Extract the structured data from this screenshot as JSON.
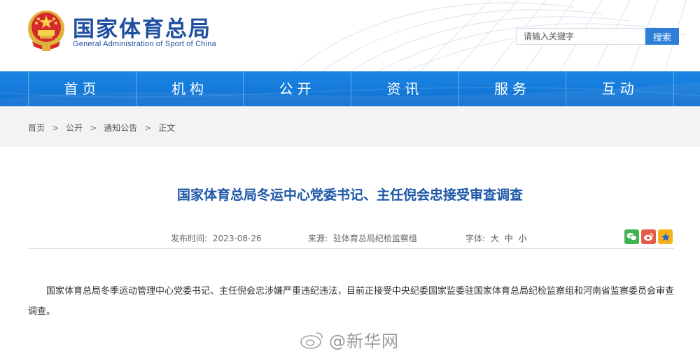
{
  "header": {
    "logo_cn": "国家体育总局",
    "logo_en": "General Administration of Sport of China",
    "search_placeholder": "请输入关键字",
    "search_button": "搜索"
  },
  "nav": {
    "items": [
      {
        "label": "首页"
      },
      {
        "label": "机构"
      },
      {
        "label": "公开"
      },
      {
        "label": "资讯"
      },
      {
        "label": "服务"
      },
      {
        "label": "互动"
      }
    ]
  },
  "breadcrumb": {
    "items": [
      "首页",
      "公开",
      "通知公告",
      "正文"
    ],
    "separator": ">"
  },
  "article": {
    "title": "国家体育总局冬运中心党委书记、主任倪会忠接受审查调查",
    "publish_label": "发布时间:",
    "publish_date": "2023-08-26",
    "source_label": "来源:",
    "source_value": "驻体育总局纪检监察组",
    "font_label": "字体:",
    "font_large": "大",
    "font_medium": "中",
    "font_small": "小",
    "body": "国家体育总局冬季运动管理中心党委书记、主任倪会忠涉嫌严重违纪违法，目前正接受中央纪委国家监委驻国家体育总局纪检监察组和河南省监察委员会审查调查。"
  },
  "share": {
    "icons": [
      "wechat-icon",
      "weibo-icon",
      "favorite-icon"
    ],
    "colors": {
      "wechat": "#3fb34f",
      "weibo": "#e65a4a",
      "favorite": "#f6b21d"
    }
  },
  "watermark": {
    "text": "@新华网"
  },
  "colors": {
    "brand_blue": "#1f4fa0",
    "nav_blue": "#1379d8",
    "title_blue": "#1d57a8",
    "search_button": "#2f7fd9"
  }
}
